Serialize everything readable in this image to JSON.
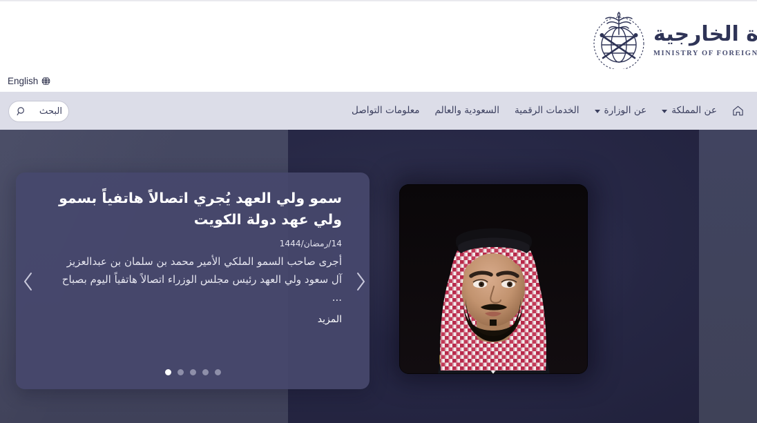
{
  "header": {
    "brand": {
      "arabic_name": "وزارة الخارجية",
      "english_name": "MINISTRY OF FOREIGN AFFAIRS",
      "emblem_icon": "saudi-emblem-palm-swords-icon"
    },
    "language_switch": {
      "label": "English",
      "icon": "globe-icon"
    }
  },
  "nav": {
    "home_icon": "home-icon",
    "items": [
      {
        "label": "عن المملكة",
        "has_dropdown": true
      },
      {
        "label": "عن الوزارة",
        "has_dropdown": true
      },
      {
        "label": "الخدمات الرقمية",
        "has_dropdown": false
      },
      {
        "label": "السعودية والعالم",
        "has_dropdown": false
      },
      {
        "label": "معلومات التواصل",
        "has_dropdown": false
      }
    ]
  },
  "search": {
    "label": "البحث",
    "icon": "search-icon"
  },
  "hero": {
    "news": {
      "title": "سمو ولي العهد يُجري اتصالاً هاتفياً بسمو ولي عهد دولة الكويت",
      "date": "14/رمضان/1444",
      "excerpt": "أجرى صاحب السمو الملكي الأمير محمد بن سلمان بن عبدالعزيز آل سعود ولي العهد رئيس مجلس الوزراء اتصالاً هاتفياً اليوم بصباح ...",
      "more_label": "المزيد"
    },
    "carousel": {
      "total_slides": 5,
      "active_slide": 5,
      "prev_icon": "chevron-left-icon",
      "next_icon": "chevron-right-icon"
    },
    "portrait_alt": "crown-prince-portrait"
  },
  "colors": {
    "nav_band": "#dcdde8",
    "hero_left": "#434660",
    "hero_right": "#262744",
    "card": "#47486c",
    "brand_navy": "#2f3457",
    "text_light": "#e6e6f0"
  }
}
